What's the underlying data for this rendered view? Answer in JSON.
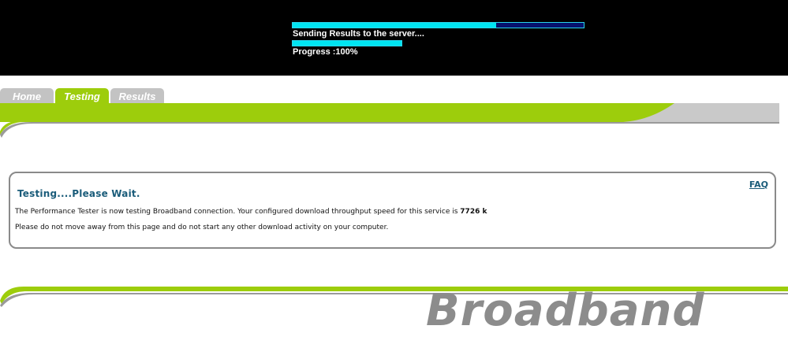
{
  "applet": {
    "send_progress": 0.7,
    "status_text": "Sending Results to the server....",
    "overall_progress": 1.0,
    "progress_text": "Progress :100%"
  },
  "tabs": [
    {
      "label": "Home",
      "active": false
    },
    {
      "label": "Testing",
      "active": true
    },
    {
      "label": "Results",
      "active": false
    }
  ],
  "panel": {
    "faq_label": "FAQ",
    "title": "Testing....Please Wait.",
    "line1_prefix": "The Performance Tester is now testing Broadband connection. Your configured download throughput speed for this service is ",
    "line1_speed": "7726 k",
    "line2": "Please do not move away from this page and do not start any other download activity on your computer."
  },
  "brand": "Broadband",
  "colors": {
    "accent_green": "#9dcd0c",
    "tab_gray": "#c3c3c3",
    "progress_cyan": "#00e5f2",
    "progress_track": "#06116e",
    "heading_teal": "#1a5c7a"
  }
}
